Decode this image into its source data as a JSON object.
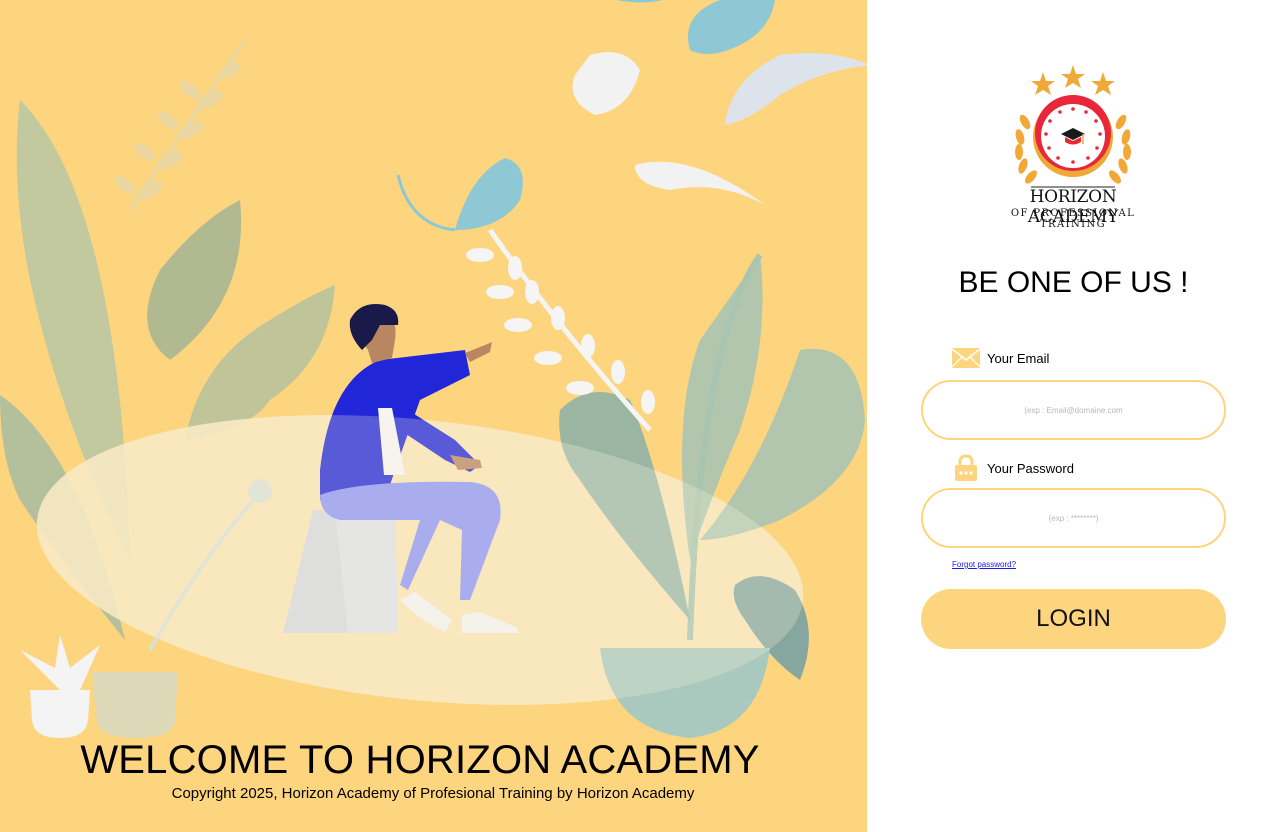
{
  "left": {
    "welcome_title": "WELCOME TO HORIZON ACADEMY",
    "copyright": "Copyright 2025, Horizon Academy of Profesional Training by Horizon Academy"
  },
  "logo": {
    "line1": "HORIZON ACADEMY",
    "line2": "OF PROFESSIONAL TRAINING"
  },
  "form": {
    "headline": "BE ONE OF US !",
    "email_label": "Your Email",
    "email_placeholder": "(exp : Email@domaine.com",
    "password_label": "Your Password",
    "password_placeholder": "(exp : ********)",
    "forgot_link": "Forgot password?",
    "login_label": "LOGIN"
  },
  "icons": {
    "email": "envelope-icon",
    "password": "padlock-icon"
  },
  "colors": {
    "accent": "#fed57f",
    "link": "#1a1aee",
    "figure_shirt": "#2127d8",
    "figure_pants": "#8e96f5"
  }
}
